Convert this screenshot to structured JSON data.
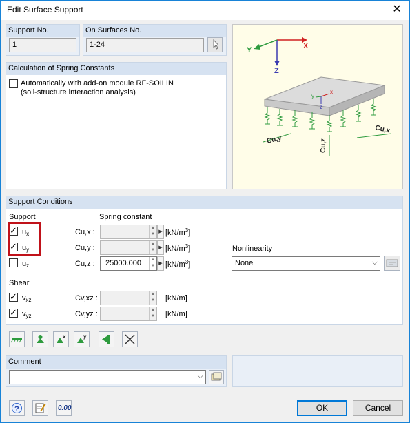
{
  "window": {
    "title": "Edit Surface Support"
  },
  "support_no": {
    "label": "Support No.",
    "value": "1"
  },
  "on_surfaces": {
    "label": "On Surfaces No.",
    "value": "1-24"
  },
  "calc": {
    "header": "Calculation of Spring Constants",
    "auto_label_line1": "Automatically with add-on module RF-SOILIN",
    "auto_label_line2": "(soil-structure interaction analysis)",
    "auto_checked": false
  },
  "diagram": {
    "y_axis": "Y",
    "x_axis": "X",
    "z_axis": "Z",
    "small_y": "y",
    "small_x": "x",
    "small_z": "z",
    "cu_y": "Cu,y",
    "cu_x": "Cu,x",
    "cu_z": "Cu,z"
  },
  "support_conditions": {
    "header": "Support Conditions",
    "support_label": "Support",
    "spring_label": "Spring constant",
    "rows": [
      {
        "name": "u",
        "sub": "x",
        "checked": true,
        "c": "Cu,x :",
        "value": "",
        "unit": "[kN/m",
        "unit_sup": "3",
        "unit_end": "]"
      },
      {
        "name": "u",
        "sub": "y",
        "checked": true,
        "c": "Cu,y :",
        "value": "",
        "unit": "[kN/m",
        "unit_sup": "3",
        "unit_end": "]"
      },
      {
        "name": "u",
        "sub": "z",
        "checked": false,
        "c": "Cu,z :",
        "value": "25000.000",
        "unit": "[kN/m",
        "unit_sup": "3",
        "unit_end": "]"
      }
    ],
    "shear_label": "Shear",
    "shear_rows": [
      {
        "name": "v",
        "sub": "xz",
        "checked": true,
        "c": "Cv,xz :",
        "value": "",
        "unit": "[kN/m]"
      },
      {
        "name": "v",
        "sub": "yz",
        "checked": true,
        "c": "Cv,yz :",
        "value": "",
        "unit": "[kN/m]"
      }
    ],
    "nonlinearity_label": "Nonlinearity",
    "nonlinearity_value": "None"
  },
  "comment": {
    "label": "Comment",
    "value": ""
  },
  "buttons": {
    "ok": "OK",
    "cancel": "Cancel",
    "units": "0.00"
  },
  "colors": {
    "accent": "#0078d7",
    "highlight": "#c0121a",
    "panel_head": "#d6e2f1",
    "green": "#2e9b3e"
  }
}
